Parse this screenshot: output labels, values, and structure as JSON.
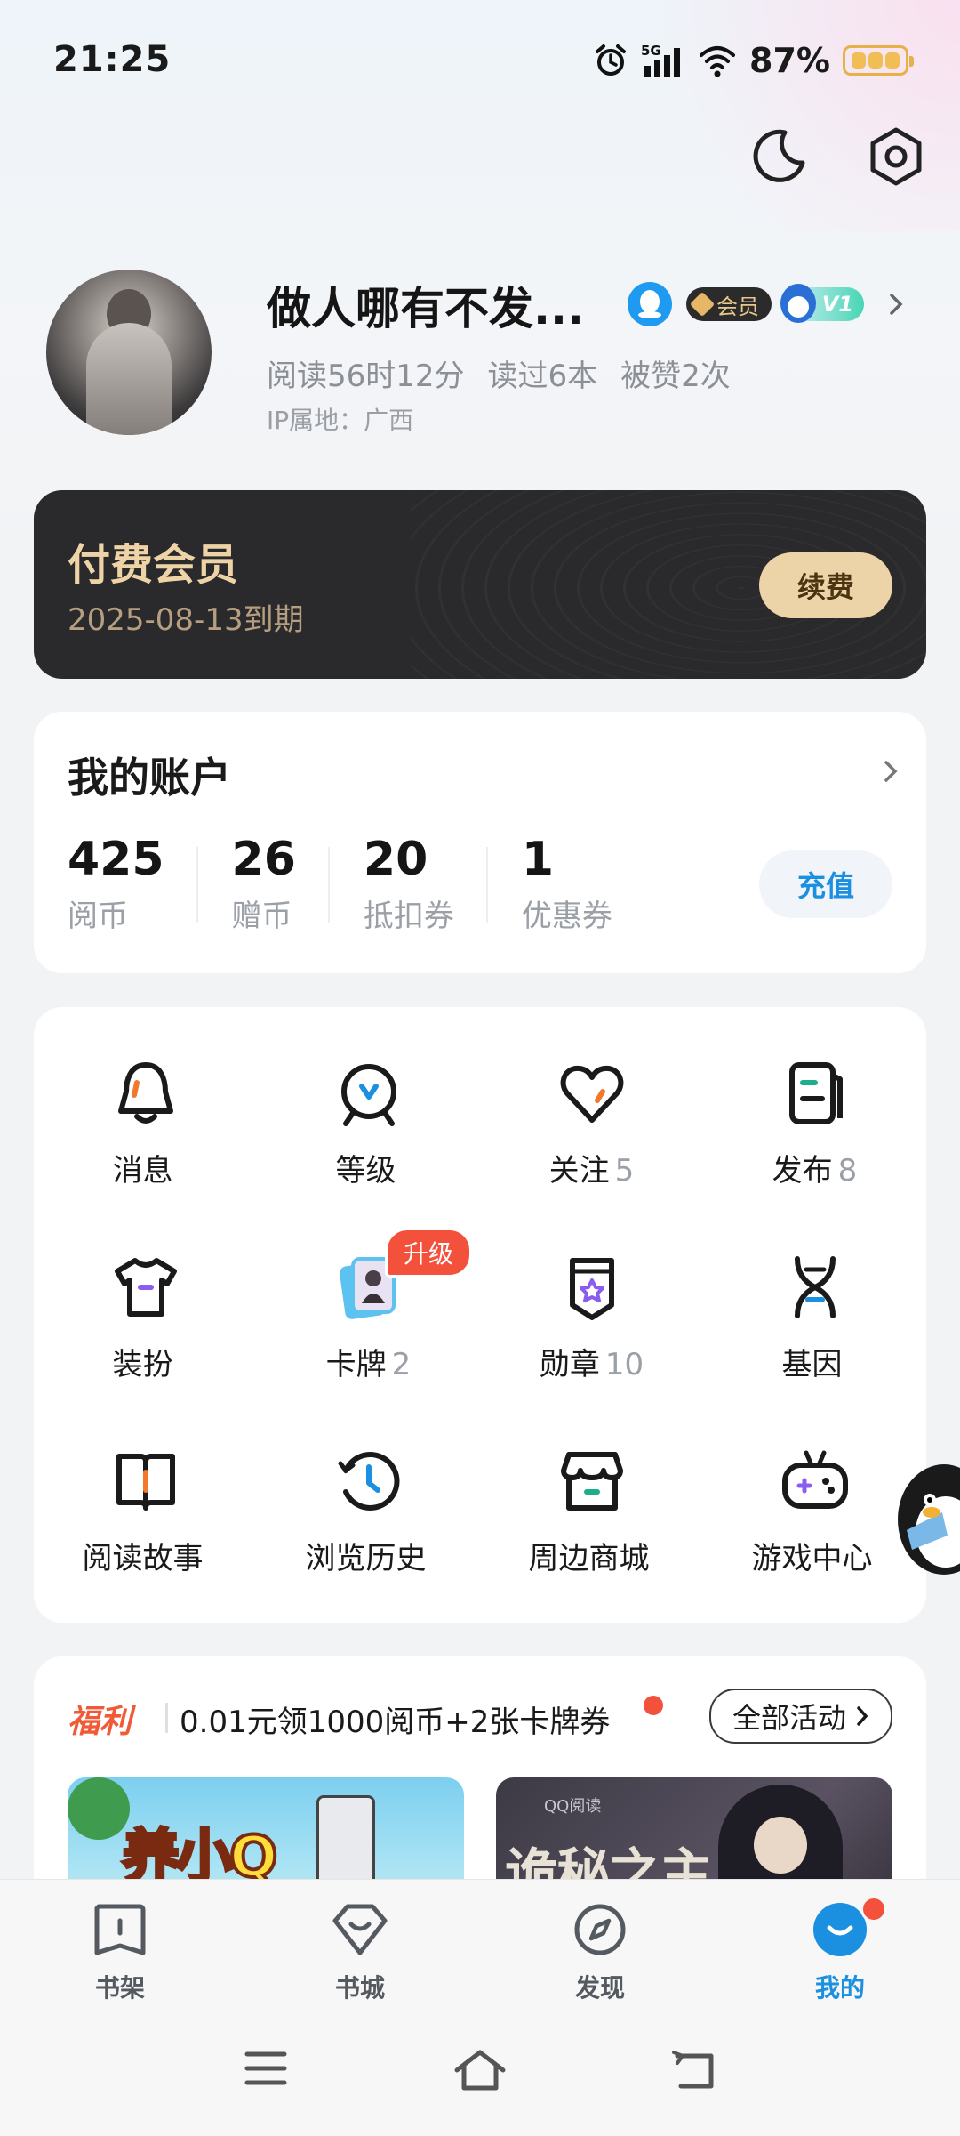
{
  "status": {
    "time": "21:25",
    "network": "5G",
    "battery": "87%"
  },
  "profile": {
    "name": "做人哪有不发...",
    "badge_vip": "会员",
    "badge_level": "V1",
    "stat_read_time": "阅读56时12分",
    "stat_books": "读过6本",
    "stat_likes": "被赞2次",
    "ip": "IP属地：广西"
  },
  "vip": {
    "title": "付费会员",
    "expiry": "2025-08-13到期",
    "renew_label": "续费"
  },
  "account": {
    "title": "我的账户",
    "items": [
      {
        "value": "425",
        "label": "阅币"
      },
      {
        "value": "26",
        "label": "赠币"
      },
      {
        "value": "20",
        "label": "抵扣券"
      },
      {
        "value": "1",
        "label": "优惠券"
      }
    ],
    "recharge_label": "充值"
  },
  "grid": {
    "items": [
      {
        "label": "消息",
        "count": ""
      },
      {
        "label": "等级",
        "count": ""
      },
      {
        "label": "关注",
        "count": "5"
      },
      {
        "label": "发布",
        "count": "8"
      },
      {
        "label": "装扮",
        "count": ""
      },
      {
        "label": "卡牌",
        "count": "2"
      },
      {
        "label": "勋章",
        "count": "10"
      },
      {
        "label": "基因",
        "count": ""
      },
      {
        "label": "阅读故事",
        "count": ""
      },
      {
        "label": "浏览历史",
        "count": ""
      },
      {
        "label": "周边商城",
        "count": ""
      },
      {
        "label": "游戏中心",
        "count": ""
      }
    ],
    "upgrade_badge": "升级"
  },
  "welfare": {
    "tag": "福利",
    "text": "0.01元领1000阅币+2张卡牌券",
    "all_label": "全部活动",
    "banner_a_title": "养小Q",
    "banner_b_logo": "QQ阅读",
    "banner_b_title": "诡秘之主"
  },
  "tabs": [
    {
      "label": "书架"
    },
    {
      "label": "书城"
    },
    {
      "label": "发现"
    },
    {
      "label": "我的"
    }
  ],
  "colors": {
    "accent": "#1b8fe0",
    "vip_gold": "#eed3a7",
    "alert_red": "#f4513c",
    "orange": "#f05a36"
  },
  "icons": [
    "alarm-icon",
    "signal-icon",
    "wifi-icon",
    "battery-icon",
    "moon-icon",
    "settings-icon",
    "qq-icon",
    "bell-icon",
    "level-icon",
    "heart-icon",
    "publish-icon",
    "shirt-icon",
    "cards-icon",
    "medal-icon",
    "dna-icon",
    "book-icon",
    "history-icon",
    "shop-icon",
    "gamepad-icon",
    "bookshelf-icon",
    "store-icon",
    "compass-icon",
    "profile-icon",
    "menu-icon",
    "home-icon",
    "back-icon"
  ]
}
